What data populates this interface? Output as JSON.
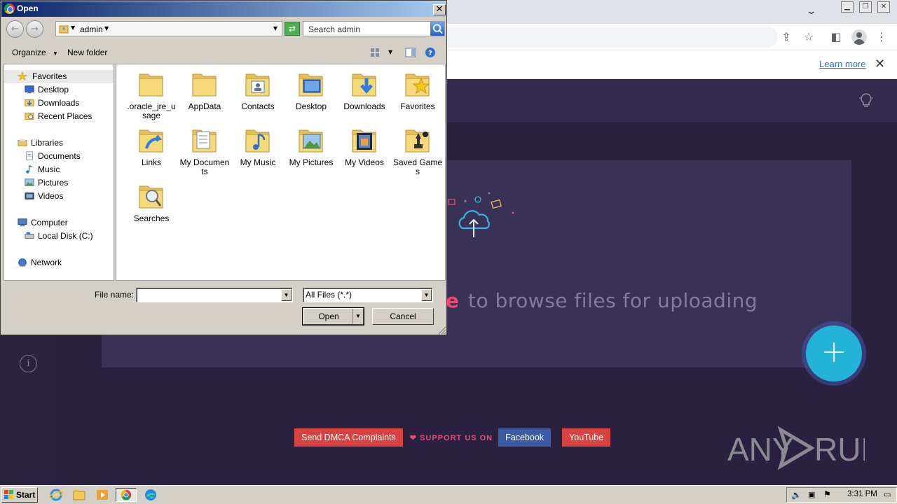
{
  "dialog": {
    "title": "Open",
    "address": "admin",
    "search_placeholder": "Search admin",
    "toolbar": {
      "organize": "Organize",
      "new_folder": "New folder"
    },
    "nav": [
      {
        "label": "Favorites",
        "icon": "star-icon",
        "level": 0
      },
      {
        "label": "Desktop",
        "icon": "desktop-icon",
        "level": 1
      },
      {
        "label": "Downloads",
        "icon": "downloads-icon",
        "level": 1
      },
      {
        "label": "Recent Places",
        "icon": "recent-places-icon",
        "level": 1
      },
      {
        "label": "Libraries",
        "icon": "libraries-icon",
        "level": 0
      },
      {
        "label": "Documents",
        "icon": "documents-icon",
        "level": 1
      },
      {
        "label": "Music",
        "icon": "music-icon",
        "level": 1
      },
      {
        "label": "Pictures",
        "icon": "pictures-icon",
        "level": 1
      },
      {
        "label": "Videos",
        "icon": "videos-icon",
        "level": 1
      },
      {
        "label": "Computer",
        "icon": "computer-icon",
        "level": 0
      },
      {
        "label": "Local Disk (C:)",
        "icon": "disk-icon",
        "level": 1
      },
      {
        "label": "Network",
        "icon": "network-icon",
        "level": 0
      }
    ],
    "files": [
      {
        "label": ".oracle_jre_usage",
        "overlay": "none"
      },
      {
        "label": "AppData",
        "overlay": "none"
      },
      {
        "label": "Contacts",
        "overlay": "contacts"
      },
      {
        "label": "Desktop",
        "overlay": "desktop"
      },
      {
        "label": "Downloads",
        "overlay": "downloads"
      },
      {
        "label": "Favorites",
        "overlay": "favorites"
      },
      {
        "label": "Links",
        "overlay": "links"
      },
      {
        "label": "My Documents",
        "overlay": "documents"
      },
      {
        "label": "My Music",
        "overlay": "music"
      },
      {
        "label": "My Pictures",
        "overlay": "pictures"
      },
      {
        "label": "My Videos",
        "overlay": "videos"
      },
      {
        "label": "Saved Games",
        "overlay": "games"
      },
      {
        "label": "Searches",
        "overlay": "searches"
      }
    ],
    "file_name_label": "File name:",
    "file_name_value": "",
    "file_type": "All Files (*.*)",
    "open_label": "Open",
    "cancel_label": "Cancel"
  },
  "browser": {
    "infobar_link": "Learn more"
  },
  "page": {
    "browse_prefix": "e",
    "browse_text": "to browse files for uploading",
    "footer": {
      "dmca": "Send DMCA Complaints",
      "support": "SUPPORT US ON",
      "facebook": "Facebook",
      "youtube": "YouTube"
    },
    "watermark": "ANY RUN"
  },
  "taskbar": {
    "start": "Start",
    "clock": "3:31 PM"
  },
  "colors": {
    "page_bg": "#2b2240",
    "accent_pink": "#e84a78",
    "fab": "#23b2d8",
    "dmca_red": "#d9433f",
    "facebook_blue": "#3b5ba5"
  }
}
